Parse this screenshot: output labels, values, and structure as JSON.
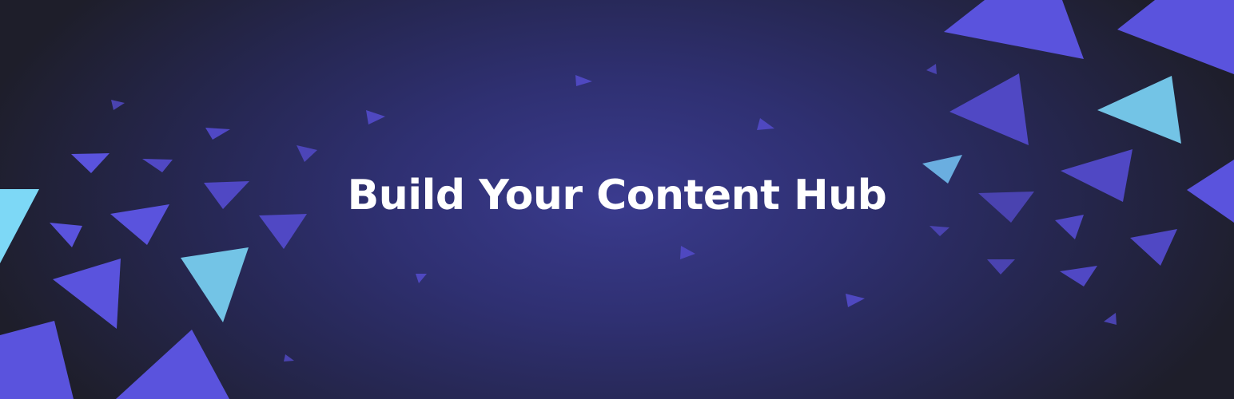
{
  "banner": {
    "headline": "Build Your Content Hub"
  },
  "colors": {
    "background_center": "#3a3b8e",
    "background_edge": "#1d1d21",
    "triangle_violet": "#5a53dd",
    "triangle_cyan": "#73c4e6",
    "triangle_light_cyan": "#7dd8f6",
    "headline": "#ffffff"
  }
}
